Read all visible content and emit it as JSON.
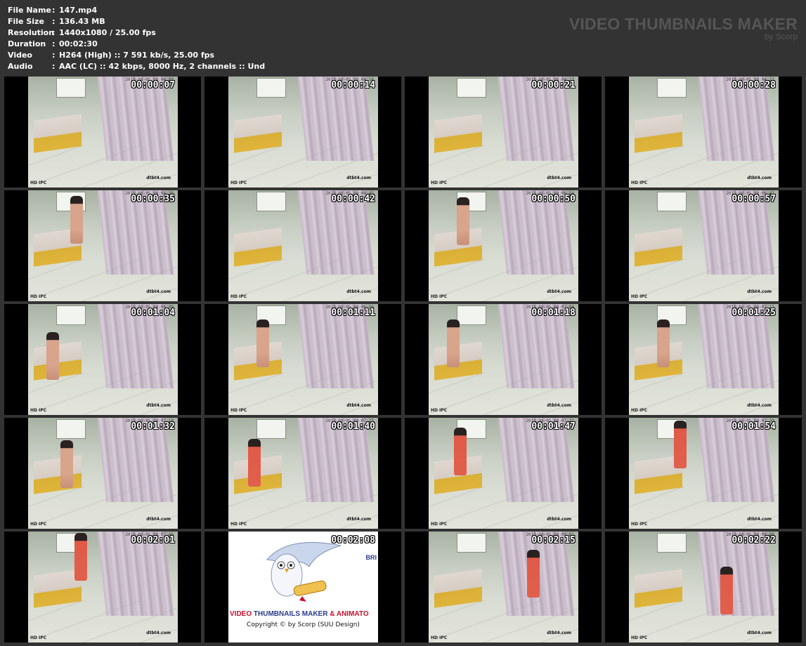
{
  "info": [
    {
      "key": "File Name",
      "sep": ":",
      "value": "147.mp4"
    },
    {
      "key": "File Size",
      "sep": ":",
      "value": "136.43 MB"
    },
    {
      "key": "Resolution",
      "sep": ":",
      "value": "1440x1080 / 25.00 fps"
    },
    {
      "key": "Duration",
      "sep": ":",
      "value": "00:02:30"
    },
    {
      "key": "Video",
      "sep": ":",
      "value": "H264 (High) :: 7 591 kb/s, 25.00 fps"
    },
    {
      "key": "Audio",
      "sep": ":",
      "value": "AAC (LC) :: 42 kbps, 8000 Hz, 2 channels :: Und"
    }
  ],
  "brand": {
    "title": "VIDEO THUMBNAILS MAKER",
    "subtitle": "by Scorp"
  },
  "camera": {
    "hd_label": "HD IPC",
    "watermark": "dtbt4.com"
  },
  "logo": {
    "title_part1": "VIDEO ",
    "title_part2": "THUMBNAILS MAKER",
    "title_part3": " & ANIMATO",
    "copyright": "Copyright © by Scorp (SUU Design)",
    "side_text": "BRI"
  },
  "thumbnails": [
    {
      "timecode": "00:00:07",
      "camera_time": "2019-08-05 08:04:09",
      "figure": "none"
    },
    {
      "timecode": "00:00:14",
      "camera_time": "2019-08-05 08:04:16",
      "figure": "none"
    },
    {
      "timecode": "00:00:21",
      "camera_time": "2019-08-05 08:04:23",
      "figure": "none"
    },
    {
      "timecode": "00:00:28",
      "camera_time": "2019-08-05 08:04:31",
      "figure": "none"
    },
    {
      "timecode": "00:00:35",
      "camera_time": "2019-08-05 08:04:38",
      "figure": "skin"
    },
    {
      "timecode": "00:00:42",
      "camera_time": "2019-08-05 08:04:45",
      "figure": "none"
    },
    {
      "timecode": "00:00:50",
      "camera_time": "2019-08-05 08:06:54",
      "figure": "skin"
    },
    {
      "timecode": "00:00:57",
      "camera_time": "2019-08-05 08:06:42",
      "figure": "none"
    },
    {
      "timecode": "00:01:04",
      "camera_time": "2019-08-05 08:06:49",
      "figure": "skin"
    },
    {
      "timecode": "00:01:11",
      "camera_time": "2019-08-05 08:06:56",
      "figure": "skin"
    },
    {
      "timecode": "00:01:18",
      "camera_time": "2019-08-05 08:07:04",
      "figure": "skin"
    },
    {
      "timecode": "00:01:25",
      "camera_time": "2019-08-05 08:07:11",
      "figure": "skin"
    },
    {
      "timecode": "00:01:32",
      "camera_time": "2019-08-05 08:07:18",
      "figure": "skin"
    },
    {
      "timecode": "00:01:40",
      "camera_time": "2019-08-05 08:07:25",
      "figure": "dress"
    },
    {
      "timecode": "00:01:47",
      "camera_time": "2019-08-05 08:07:32",
      "figure": "dress"
    },
    {
      "timecode": "00:01:54",
      "camera_time": "2019-08-05 08:07:39",
      "figure": "dress"
    },
    {
      "timecode": "00:02:01",
      "camera_time": "2019-08-05 08:07:46",
      "figure": "dress"
    },
    {
      "timecode": "00:02:08",
      "camera_time": "",
      "figure": "logo"
    },
    {
      "timecode": "00:02:15",
      "camera_time": "2019-08-05 08:08:01",
      "figure": "dress"
    },
    {
      "timecode": "00:02:22",
      "camera_time": "2019-08-05 08:08:08",
      "figure": "dress"
    }
  ]
}
